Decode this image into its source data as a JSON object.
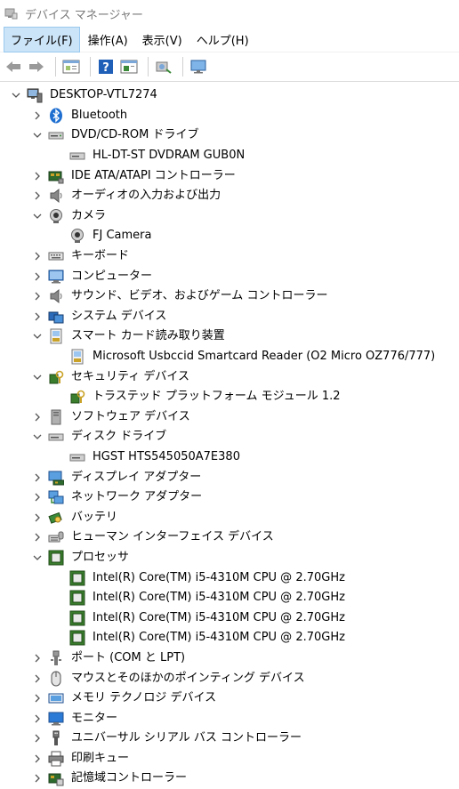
{
  "window": {
    "title": "デバイス マネージャー"
  },
  "menu": [
    {
      "label": "ファイル(F)",
      "active": true
    },
    {
      "label": "操作(A)",
      "active": false
    },
    {
      "label": "表示(V)",
      "active": false
    },
    {
      "label": "ヘルプ(H)",
      "active": false
    }
  ],
  "toolbar": [
    "back-icon",
    "forward-icon",
    "properties-icon",
    "help-icon",
    "view-icon",
    "scan-hardware-icon",
    "monitor-icon"
  ],
  "tree": {
    "root": "DESKTOP-VTL7274",
    "categories": [
      {
        "label": "Bluetooth",
        "icon": "bluetooth-icon",
        "expanded": false,
        "children": []
      },
      {
        "label": "DVD/CD-ROM ドライブ",
        "icon": "dvd-drive-icon",
        "expanded": true,
        "children": [
          "HL-DT-ST DVDRAM GUB0N"
        ]
      },
      {
        "label": "IDE ATA/ATAPI コントローラー",
        "icon": "ide-controller-icon",
        "expanded": false,
        "children": []
      },
      {
        "label": "オーディオの入力および出力",
        "icon": "speaker-icon",
        "expanded": false,
        "children": []
      },
      {
        "label": "カメラ",
        "icon": "camera-icon",
        "expanded": true,
        "children": [
          "FJ Camera"
        ]
      },
      {
        "label": "キーボード",
        "icon": "keyboard-icon",
        "expanded": false,
        "children": []
      },
      {
        "label": "コンピューター",
        "icon": "computer-icon",
        "expanded": false,
        "children": []
      },
      {
        "label": "サウンド、ビデオ、およびゲーム コントローラー",
        "icon": "speaker-icon",
        "expanded": false,
        "children": []
      },
      {
        "label": "システム デバイス",
        "icon": "system-device-icon",
        "expanded": false,
        "children": []
      },
      {
        "label": "スマート カード読み取り装置",
        "icon": "smartcard-reader-icon",
        "expanded": true,
        "children": [
          "Microsoft Usbccid Smartcard Reader (O2 Micro OZ776/777)"
        ]
      },
      {
        "label": "セキュリティ デバイス",
        "icon": "security-device-icon",
        "expanded": true,
        "children": [
          "トラステッド プラットフォーム モジュール 1.2"
        ]
      },
      {
        "label": "ソフトウェア デバイス",
        "icon": "software-device-icon",
        "expanded": false,
        "children": []
      },
      {
        "label": "ディスク ドライブ",
        "icon": "disk-drive-icon",
        "expanded": true,
        "children": [
          "HGST HTS545050A7E380"
        ]
      },
      {
        "label": "ディスプレイ アダプター",
        "icon": "display-adapter-icon",
        "expanded": false,
        "children": []
      },
      {
        "label": "ネットワーク アダプター",
        "icon": "network-adapter-icon",
        "expanded": false,
        "children": []
      },
      {
        "label": "バッテリ",
        "icon": "battery-icon",
        "expanded": false,
        "children": []
      },
      {
        "label": "ヒューマン インターフェイス デバイス",
        "icon": "hid-icon",
        "expanded": false,
        "children": []
      },
      {
        "label": "プロセッサ",
        "icon": "processor-icon",
        "expanded": true,
        "children": [
          "Intel(R) Core(TM) i5-4310M CPU @ 2.70GHz",
          "Intel(R) Core(TM) i5-4310M CPU @ 2.70GHz",
          "Intel(R) Core(TM) i5-4310M CPU @ 2.70GHz",
          "Intel(R) Core(TM) i5-4310M CPU @ 2.70GHz"
        ]
      },
      {
        "label": "ポート (COM と LPT)",
        "icon": "port-icon",
        "expanded": false,
        "children": []
      },
      {
        "label": "マウスとそのほかのポインティング デバイス",
        "icon": "mouse-icon",
        "expanded": false,
        "children": []
      },
      {
        "label": "メモリ テクノロジ デバイス",
        "icon": "memory-device-icon",
        "expanded": false,
        "children": []
      },
      {
        "label": "モニター",
        "icon": "monitor-icon",
        "expanded": false,
        "children": []
      },
      {
        "label": "ユニバーサル シリアル バス コントローラー",
        "icon": "usb-icon",
        "expanded": false,
        "children": []
      },
      {
        "label": "印刷キュー",
        "icon": "printer-icon",
        "expanded": false,
        "children": []
      },
      {
        "label": "記憶域コントローラー",
        "icon": "storage-controller-icon",
        "expanded": false,
        "children": []
      }
    ]
  },
  "colors": {
    "menu_active_bg": "#cce4f7",
    "bluetooth": "#1f6fd1",
    "processor": "#3a7d2c",
    "monitor": "#2b7bd6"
  }
}
